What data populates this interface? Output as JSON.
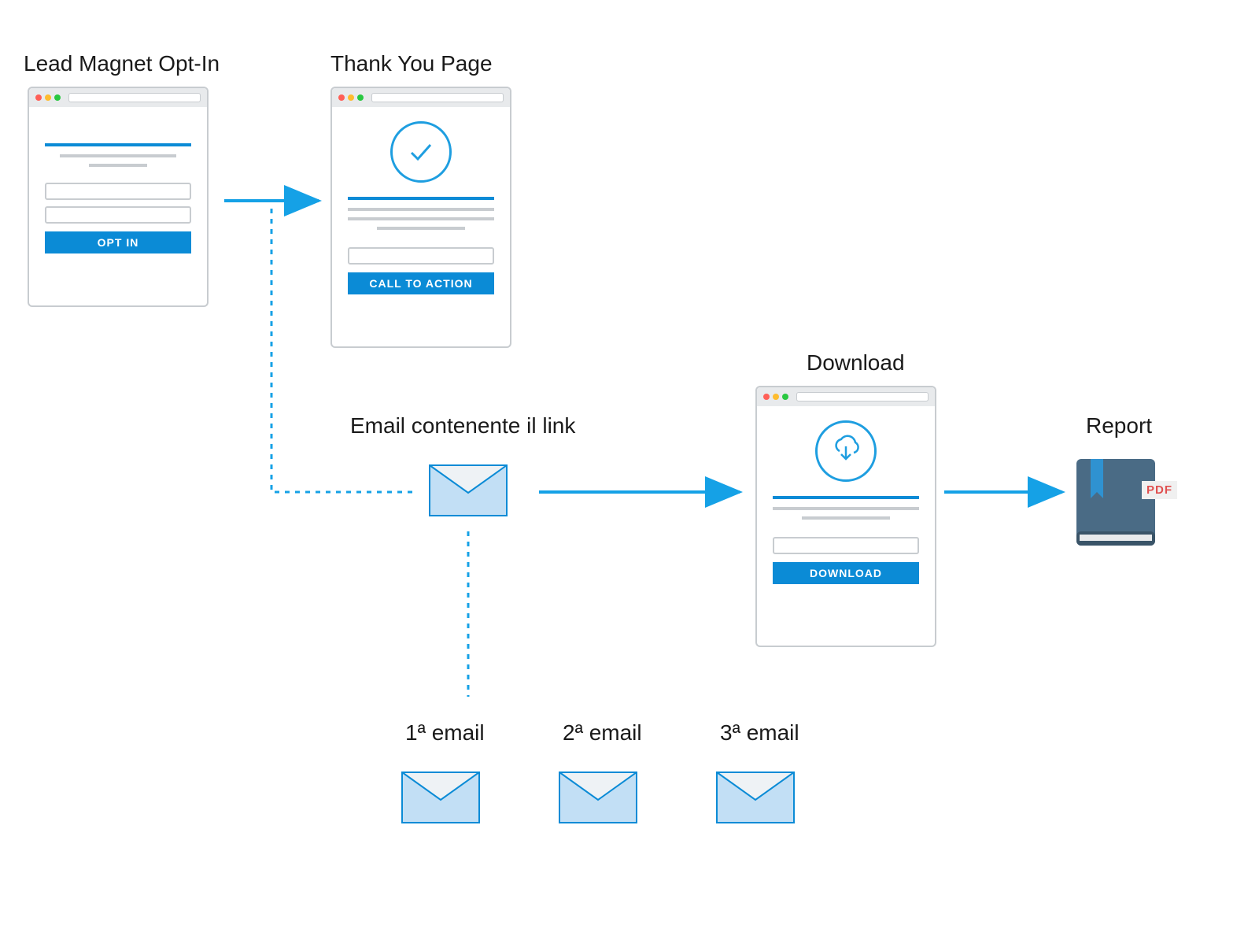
{
  "labels": {
    "opt_in": "Lead Magnet Opt-In",
    "thank_you": "Thank You Page",
    "email_link": "Email contenente il link",
    "download": "Download",
    "report": "Report",
    "email1": "1ª email",
    "email2": "2ª email",
    "email3": "3ª email"
  },
  "buttons": {
    "opt_in": "OPT IN",
    "cta": "CALL TO ACTION",
    "download": "DOWNLOAD"
  },
  "pdf_tag": "PDF",
  "colors": {
    "blue": "#0b8bd6",
    "light_blue": "#c2dff5",
    "gray": "#c8ccd0",
    "tag_red": "#e04f4f"
  }
}
